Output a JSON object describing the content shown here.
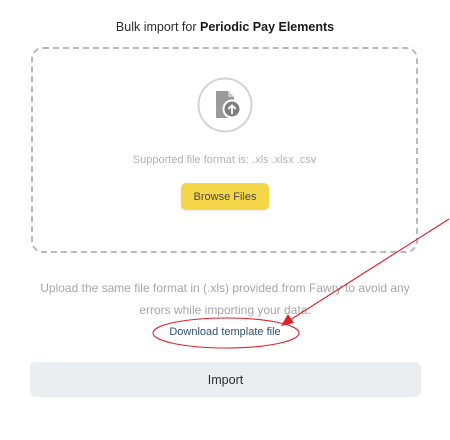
{
  "header": {
    "title_prefix": "Bulk import for ",
    "title_bold": "Periodic Pay Elements"
  },
  "dropzone": {
    "icon": "file-upload-icon",
    "supported_text": "Supported file format is: .xls .xlsx .csv",
    "browse_label": "Browse Files"
  },
  "helper_text": "Upload the same file format in (.xls) provided from Fawry to avoid any errors while importing your data.",
  "download_label": "Download template file",
  "import_label": "Import",
  "colors": {
    "browse_button": "#f5d648",
    "import_button": "#ebedf0",
    "annotation": "#e0202a",
    "link": "#2f4f70"
  }
}
